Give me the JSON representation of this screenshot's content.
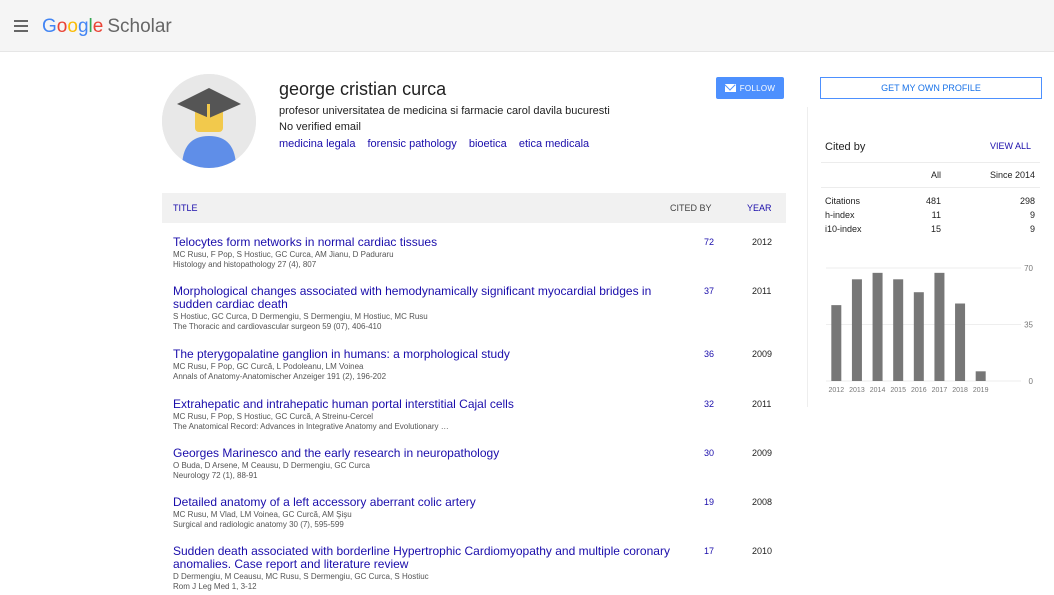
{
  "header": {
    "logo_letters": [
      "G",
      "o",
      "o",
      "g",
      "l",
      "e"
    ],
    "logo_product": "Scholar"
  },
  "profile": {
    "name": "george cristian curca",
    "affiliation": "profesor universitatea de medicina si farmacie carol davila bucuresti",
    "email": "No verified email",
    "interests": [
      "medicina legala",
      "forensic pathology",
      "bioetica",
      "etica medicala"
    ],
    "follow_label": "FOLLOW"
  },
  "table": {
    "headers": {
      "title": "TITLE",
      "cited_by": "CITED BY",
      "year": "YEAR"
    },
    "rows": [
      {
        "title": "Telocytes form networks in normal cardiac tissues",
        "authors": "MC Rusu, F Pop, S Hostiuc, GC Curca, AM Jianu, D Paduraru",
        "venue": "Histology and histopathology 27 (4), 807",
        "cited_by": "72",
        "year": "2012"
      },
      {
        "title": "Morphological changes associated with hemodynamically significant myocardial bridges in sudden cardiac death",
        "authors": "S Hostiuc, GC Curca, D Dermengiu, S Dermengiu, M Hostiuc, MC Rusu",
        "venue": "The Thoracic and cardiovascular surgeon 59 (07), 406-410",
        "cited_by": "37",
        "year": "2011"
      },
      {
        "title": "The pterygopalatine ganglion in humans: a morphological study",
        "authors": "MC Rusu, F Pop, GC Curcă, L Podoleanu, LM Voinea",
        "venue": "Annals of Anatomy-Anatomischer Anzeiger 191 (2), 196-202",
        "cited_by": "36",
        "year": "2009"
      },
      {
        "title": "Extrahepatic and intrahepatic human portal interstitial Cajal cells",
        "authors": "MC Rusu, F Pop, S Hostiuc, GC Curcă, A Streinu-Cercel",
        "venue": "The Anatomical Record: Advances in Integrative Anatomy and Evolutionary …",
        "cited_by": "32",
        "year": "2011"
      },
      {
        "title": "Georges Marinesco and the early research in neuropathology",
        "authors": "O Buda, D Arsene, M Ceausu, D Dermengiu, GC Curca",
        "venue": "Neurology 72 (1), 88-91",
        "cited_by": "30",
        "year": "2009"
      },
      {
        "title": "Detailed anatomy of a left accessory aberrant colic artery",
        "authors": "MC Rusu, M Vlad, LM Voinea, GC Curcă, AM Şişu",
        "venue": "Surgical and radiologic anatomy 30 (7), 595-599",
        "cited_by": "19",
        "year": "2008"
      },
      {
        "title": "Sudden death associated with borderline Hypertrophic Cardiomyopathy and multiple coronary anomalies. Case report and literature review",
        "authors": "D Dermengiu, M Ceausu, MC Rusu, S Dermengiu, GC Curca, S Hostiuc",
        "venue": "Rom J Leg Med 1, 3-12",
        "cited_by": "17",
        "year": "2010"
      }
    ]
  },
  "sidebar": {
    "own_profile_label": "GET MY OWN PROFILE",
    "cited_by_title": "Cited by",
    "view_all_label": "VIEW ALL",
    "col_all": "All",
    "col_since": "Since 2014",
    "metrics": [
      {
        "label": "Citations",
        "all": "481",
        "since": "298"
      },
      {
        "label": "h-index",
        "all": "11",
        "since": "9"
      },
      {
        "label": "i10-index",
        "all": "15",
        "since": "9"
      }
    ]
  },
  "chart_data": {
    "type": "bar",
    "categories": [
      "2012",
      "2013",
      "2014",
      "2015",
      "2016",
      "2017",
      "2018",
      "2019"
    ],
    "values": [
      47,
      63,
      67,
      63,
      55,
      67,
      48,
      6
    ],
    "ylim": [
      0,
      70
    ],
    "yticks": [
      "70",
      "35",
      "0"
    ],
    "bar_color": "#777777"
  }
}
